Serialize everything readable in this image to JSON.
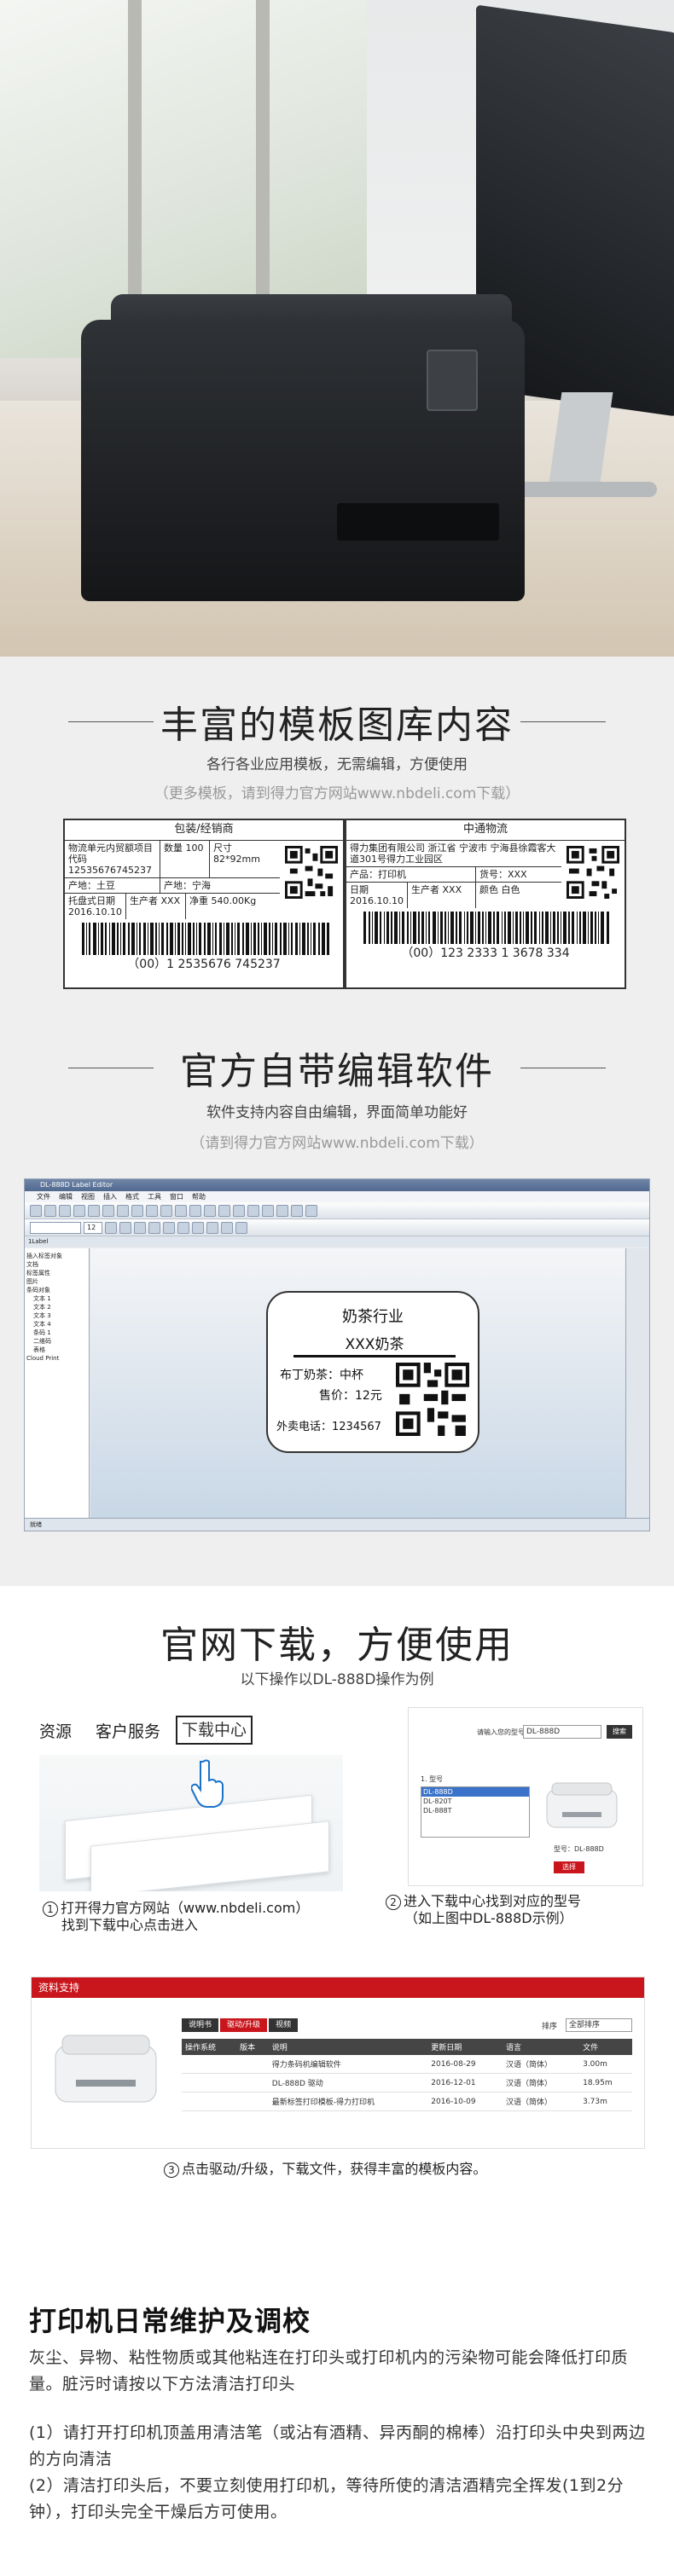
{
  "section_templates": {
    "title": "丰富的模板图库内容",
    "subtitle": "各行各业应用模板，无需编辑，方便使用",
    "note": "（更多模板，请到得力官方网站www.nbdeli.com下载）",
    "label_a": {
      "header": "包装/经销商",
      "r1c1": "物流单元内贸额项目代码 12535676745237",
      "r1c2": "数量 100",
      "r1c3": "尺寸 82*92mm",
      "r2c1": "产地：土豆",
      "r2c2": "产地：宁海",
      "r3c1": "托盘式日期 2016.10.10",
      "r3c2": "生产者 XXX",
      "r3c3": "净重 540.00Kg",
      "barcode": "（00）1 2535676 745237"
    },
    "label_b": {
      "header": "中通物流",
      "r1c1": "得力集团有限公司 浙江省 宁波市 宁海县徐霞客大道301号得力工业园区",
      "r2c1": "产品：打印机",
      "r2c2": "货号：XXX",
      "r3c1": "日期 2016.10.10",
      "r3c2": "生产者 XXX",
      "r3c3": "颜色 白色",
      "barcode": "（00）123 2333 1 3678 334"
    }
  },
  "section_software": {
    "title": "官方自带编辑软件",
    "subtitle": "软件支持内容自由编辑，界面简单功能好",
    "note": "（请到得力官方网站www.nbdeli.com下载）",
    "app": {
      "title": "DL-888D Label Editor",
      "menus": [
        "文件",
        "编辑",
        "视图",
        "插入",
        "格式",
        "工具",
        "窗口",
        "帮助"
      ],
      "font_size": "12",
      "tree": [
        "插入标签对象",
        "文档",
        "标签属性",
        "图片",
        "条码对象",
        "文本 1",
        "文本 2",
        "文本 3",
        "文本 4",
        "条码 1",
        "二维码",
        "表格",
        "Cloud Print"
      ],
      "tab": "1Label",
      "status": "就绪"
    },
    "milk_label": {
      "line1": "奶茶行业",
      "line2": "XXX奶茶",
      "line3": "布丁奶茶：中杯",
      "line4": "售价：12元",
      "line5": "外卖电话：1234567"
    }
  },
  "section_download": {
    "title": "官网下载，方便使用",
    "subtitle": "以下操作以DL-888D操作为例",
    "shot1": {
      "nav_1": "资源",
      "nav_2": "客户服务",
      "nav_3": "下载中心"
    },
    "shot2": {
      "prompt": "请输入您的型号",
      "model_value": "DL-888D",
      "search_btn": "搜索",
      "list_title": "1. 型号",
      "list_items": [
        "DL-888D",
        "DL-820T",
        "DL-888T"
      ],
      "model_caption": "型号：DL-888D",
      "select_btn": "选择"
    },
    "caption1_num": "1",
    "caption1_line1": "打开得力官方网站（www.nbdeli.com）",
    "caption1_line2": "找到下载中心点击进入",
    "caption2_num": "2",
    "caption2_line1": "进入下载中心找到对应的型号",
    "caption2_line2": "（如上图中DL-888D示例）",
    "shot3": {
      "bar_title": "资料支持",
      "tabs": [
        "说明书",
        "驱动/升级",
        "视频"
      ],
      "sort_label": "排序",
      "sort_value": "全部排序",
      "columns": [
        "操作系统",
        "版本",
        "说明",
        "更新日期",
        "语言",
        "文件"
      ],
      "rows": [
        [
          "",
          "",
          "得力条码机编辑软件",
          "2016-08-29",
          "汉语（简体）",
          "3.00m"
        ],
        [
          "",
          "",
          "DL-888D 驱动",
          "2016-12-01",
          "汉语（简体）",
          "18.95m"
        ],
        [
          "",
          "",
          "最新标签打印模板-得力打印机",
          "2016-10-09",
          "汉语（简体）",
          "3.73m"
        ]
      ]
    },
    "caption3_num": "3",
    "caption3_text": "点击驱动/升级，下载文件，获得丰富的模板内容。"
  },
  "section_maintenance": {
    "title": "打印机日常维护及调校",
    "para1": "灰尘、异物、粘性物质或其他粘连在打印头或打印机内的污染物可能会降低打印质量。脏污时请按以下方法清洁打印头",
    "para2": "(1）请打开打印机顶盖用清洁笔（或沾有酒精、异丙酮的棉棒）沿打印头中央到两边的方向清洁",
    "para3": "(2）清洁打印头后，不要立刻使用打印机，等待所使的清洁酒精完全挥发(1到2分钟），打印头完全干燥后方可使用。"
  },
  "colors": {
    "accent_red": "#c9161c",
    "heading": "#222222",
    "note_grey": "#999999",
    "band_grey": "#efefef"
  }
}
